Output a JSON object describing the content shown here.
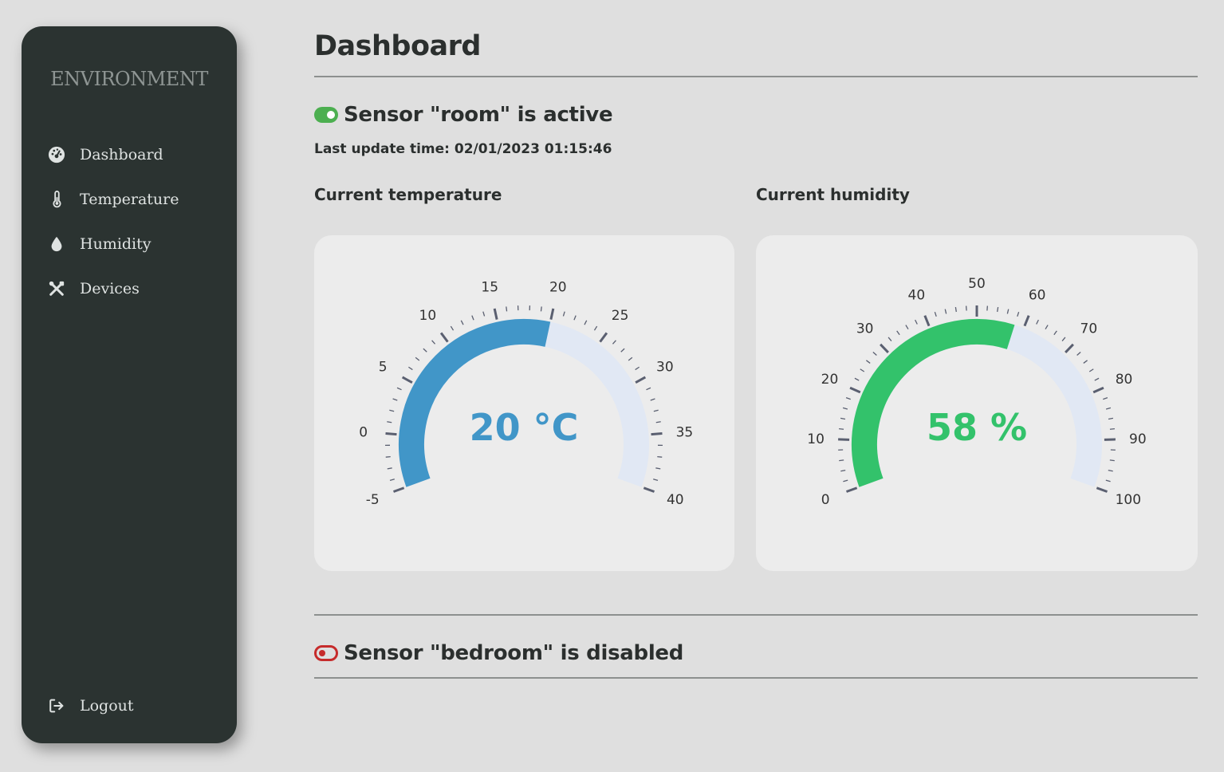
{
  "sidebar": {
    "brand": "ENVIRONMENT",
    "items": [
      {
        "label": "Dashboard",
        "icon": "gauge-icon"
      },
      {
        "label": "Temperature",
        "icon": "thermometer-icon"
      },
      {
        "label": "Humidity",
        "icon": "droplet-icon"
      },
      {
        "label": "Devices",
        "icon": "tools-icon"
      }
    ],
    "logout": {
      "label": "Logout",
      "icon": "logout-icon"
    }
  },
  "main": {
    "title": "Dashboard",
    "sensors": [
      {
        "title": "Sensor \"room\" is active",
        "status": "active",
        "last_update": "Last update time: 02/01/2023 01:15:46",
        "gauges": [
          {
            "label": "Current temperature",
            "value": 20,
            "display": "20 °C",
            "min": -5,
            "max": 40,
            "major_ticks": [
              -5,
              0,
              5,
              10,
              15,
              20,
              25,
              30,
              35,
              40
            ],
            "minor_per_major": 5,
            "color": "#4196c8",
            "track_color": "#e1e8f4"
          },
          {
            "label": "Current humidity",
            "value": 58,
            "display": "58 %",
            "min": 0,
            "max": 100,
            "major_ticks": [
              0,
              10,
              20,
              30,
              40,
              50,
              60,
              70,
              80,
              90,
              100
            ],
            "minor_per_major": 5,
            "color": "#33c26b",
            "track_color": "#e1e8f4"
          }
        ]
      },
      {
        "title": "Sensor \"bedroom\" is disabled",
        "status": "disabled"
      }
    ]
  },
  "colors": {
    "sidebar_bg": "#2b3331",
    "page_bg": "#dfdfdf",
    "card_bg": "#ececec",
    "active": "#4caf50",
    "disabled": "#c62b2b",
    "tick": "#5a5f70"
  }
}
